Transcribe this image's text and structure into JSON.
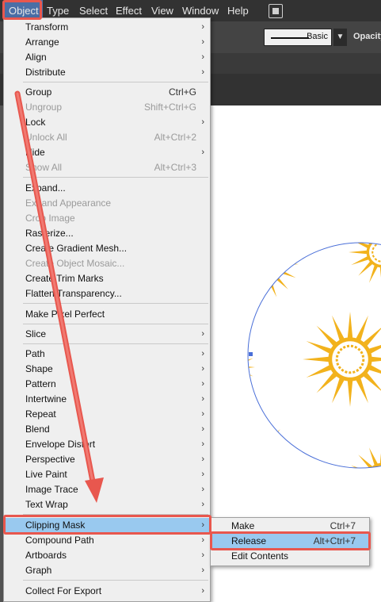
{
  "menubar": {
    "items": [
      "Object",
      "Type",
      "Select",
      "Effect",
      "View",
      "Window",
      "Help"
    ],
    "workspace_icon": "workspace-icon"
  },
  "control_bar": {
    "stroke_style": "Basic",
    "opacity_label": "Opacity:"
  },
  "object_menu": {
    "items": [
      {
        "label": "Transform",
        "submenu": true
      },
      {
        "label": "Arrange",
        "submenu": true
      },
      {
        "label": "Align",
        "submenu": true
      },
      {
        "label": "Distribute",
        "submenu": true
      },
      {
        "label": "Group",
        "shortcut": "Ctrl+G"
      },
      {
        "label": "Ungroup",
        "shortcut": "Shift+Ctrl+G",
        "disabled": true
      },
      {
        "label": "Lock",
        "submenu": true
      },
      {
        "label": "Unlock All",
        "shortcut": "Alt+Ctrl+2",
        "disabled": true
      },
      {
        "label": "Hide",
        "submenu": true
      },
      {
        "label": "Show All",
        "shortcut": "Alt+Ctrl+3",
        "disabled": true
      },
      {
        "label": "Expand..."
      },
      {
        "label": "Expand Appearance",
        "disabled": true
      },
      {
        "label": "Crop Image",
        "disabled": true
      },
      {
        "label": "Rasterize..."
      },
      {
        "label": "Create Gradient Mesh..."
      },
      {
        "label": "Create Object Mosaic...",
        "disabled": true
      },
      {
        "label": "Create Trim Marks"
      },
      {
        "label": "Flatten Transparency..."
      },
      {
        "label": "Make Pixel Perfect"
      },
      {
        "label": "Slice",
        "submenu": true
      },
      {
        "label": "Path",
        "submenu": true
      },
      {
        "label": "Shape",
        "submenu": true
      },
      {
        "label": "Pattern",
        "submenu": true
      },
      {
        "label": "Intertwine",
        "submenu": true
      },
      {
        "label": "Repeat",
        "submenu": true
      },
      {
        "label": "Blend",
        "submenu": true
      },
      {
        "label": "Envelope Distort",
        "submenu": true
      },
      {
        "label": "Perspective",
        "submenu": true
      },
      {
        "label": "Live Paint",
        "submenu": true
      },
      {
        "label": "Image Trace",
        "submenu": true
      },
      {
        "label": "Text Wrap",
        "submenu": true
      },
      {
        "label": "Clipping Mask",
        "submenu": true,
        "highlighted": true
      },
      {
        "label": "Compound Path",
        "submenu": true
      },
      {
        "label": "Artboards",
        "submenu": true
      },
      {
        "label": "Graph",
        "submenu": true
      },
      {
        "label": "Collect For Export",
        "submenu": true
      }
    ]
  },
  "clipping_submenu": {
    "items": [
      {
        "label": "Make",
        "shortcut": "Ctrl+7"
      },
      {
        "label": "Release",
        "shortcut": "Alt+Ctrl+7",
        "highlighted": true
      },
      {
        "label": "Edit Contents"
      }
    ]
  },
  "colors": {
    "highlight": "#99c9ef",
    "annotation": "#e8574e",
    "artwork": "#f2b21c",
    "selection": "#4a6fd8"
  }
}
